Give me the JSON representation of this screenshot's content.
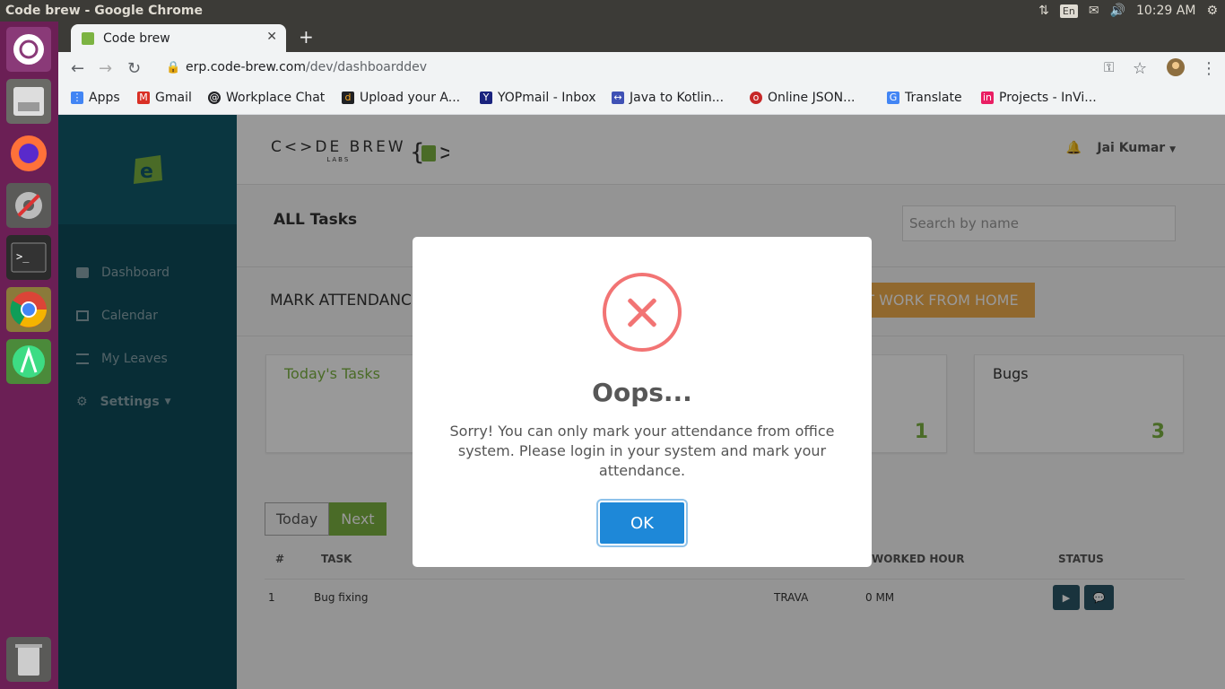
{
  "os": {
    "window_title": "Code brew - Google Chrome",
    "keyboard": "En",
    "clock": "10:29 AM"
  },
  "browser": {
    "tab_title": "Code brew",
    "url_domain": "erp.code-brew.com",
    "url_path": "/dev/dashboarddev",
    "bookmarks": [
      {
        "label": "Apps",
        "icon": "apps-grid-icon",
        "color": "#4285f4"
      },
      {
        "label": "Gmail",
        "icon": "gmail-icon",
        "color": "#d93025"
      },
      {
        "label": "Workplace Chat",
        "icon": "workplace-icon",
        "color": "#202124"
      },
      {
        "label": "Upload your A...",
        "icon": "upload-d-icon",
        "color": "#202124"
      },
      {
        "label": "YOPmail - Inbox",
        "icon": "yopmail-icon",
        "color": "#1a237e"
      },
      {
        "label": "Java to Kotlin...",
        "icon": "converter-icon",
        "color": "#3f51b5"
      },
      {
        "label": "Online JSON...",
        "icon": "json-icon",
        "color": "#c62828"
      },
      {
        "label": "Translate",
        "icon": "translate-icon",
        "color": "#4285f4"
      },
      {
        "label": "Projects - InVi...",
        "icon": "invision-icon",
        "color": "#e91e63"
      }
    ]
  },
  "app": {
    "brand_name": "C<>DE BREW",
    "brand_sub": "LABS",
    "user_name": "Jai Kumar",
    "sidebar": [
      {
        "label": "Dashboard",
        "icon": "briefcase-icon"
      },
      {
        "label": "Calendar",
        "icon": "calendar-icon"
      },
      {
        "label": "My Leaves",
        "icon": "list-icon"
      },
      {
        "label": "Settings",
        "icon": "gear-icon"
      }
    ],
    "section_title": "ALL Tasks",
    "search_placeholder": "Search by name",
    "mark_attendance": "MARK ATTENDANCE",
    "wfh_button": "REQUEST WORK FROM HOME",
    "cards": [
      {
        "title": "Today's Tasks",
        "count": ""
      },
      {
        "title": "",
        "count": "1"
      },
      {
        "title": "Bugs",
        "count": "3"
      }
    ],
    "toggle": {
      "today": "Today",
      "next": "Next"
    },
    "table": {
      "headers": [
        "#",
        "TASK",
        "WORKED HOUR",
        "STATUS"
      ],
      "rows": [
        {
          "num": "1",
          "task": "Bug fixing",
          "project": "TRAVA",
          "hours": "0 MM"
        }
      ]
    }
  },
  "modal": {
    "title": "Oops...",
    "message": "Sorry! You can only mark your attendance from office system. Please login in your system and mark your attendance.",
    "ok_label": "OK",
    "error_color": "#f27474",
    "button_color": "#1e88d8"
  }
}
